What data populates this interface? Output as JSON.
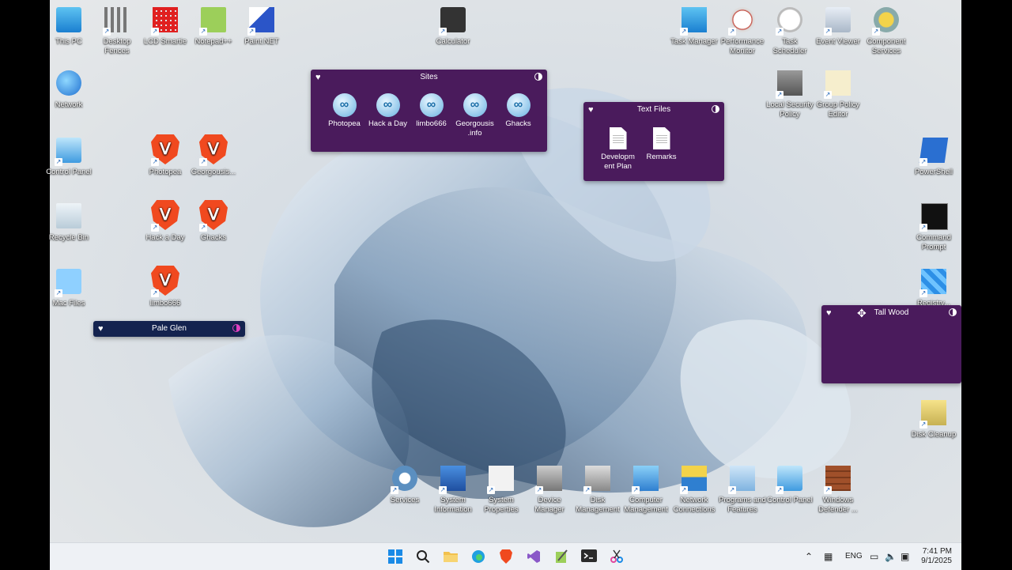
{
  "desktop_icons": [
    {
      "label": "This PC",
      "icon": "monitor-icon"
    },
    {
      "label": "Desktop Fences",
      "icon": "fence-icon"
    },
    {
      "label": "LCD Smartie",
      "icon": "lcd-icon"
    },
    {
      "label": "Notepad++",
      "icon": "notepadpp-icon"
    },
    {
      "label": "Paint.NET",
      "icon": "paint-icon"
    },
    {
      "label": "Calculator",
      "icon": "calculator-icon"
    },
    {
      "label": "Task Manager",
      "icon": "taskmanager-icon"
    },
    {
      "label": "Performance Monitor",
      "icon": "gauge-icon"
    },
    {
      "label": "Task Scheduler",
      "icon": "clock-icon"
    },
    {
      "label": "Event Viewer",
      "icon": "eventviewer-icon"
    },
    {
      "label": "Component Services",
      "icon": "component-icon"
    },
    {
      "label": "Network",
      "icon": "globe-icon"
    },
    {
      "label": "Local Security Policy",
      "icon": "security-icon"
    },
    {
      "label": "Group Policy Editor",
      "icon": "policy-icon"
    },
    {
      "label": "Control Panel",
      "icon": "controlpanel-icon"
    },
    {
      "label": "Photopea",
      "icon": "brave-icon"
    },
    {
      "label": "Georgousis...",
      "icon": "brave-icon"
    },
    {
      "label": "PowerShell",
      "icon": "powershell-icon"
    },
    {
      "label": "Recycle Bin",
      "icon": "recycle-icon"
    },
    {
      "label": "Hack a Day",
      "icon": "brave-icon"
    },
    {
      "label": "Ghacks",
      "icon": "brave-icon"
    },
    {
      "label": "Command Prompt",
      "icon": "cmd-icon"
    },
    {
      "label": "Mac Files",
      "icon": "folder-icon"
    },
    {
      "label": "limbo666",
      "icon": "brave-icon"
    },
    {
      "label": "Registry...",
      "icon": "registry-icon"
    },
    {
      "label": "Disk Cleanup",
      "icon": "diskcleanup-icon"
    },
    {
      "label": "Services",
      "icon": "gears-icon"
    },
    {
      "label": "System Information",
      "icon": "sysinfo-icon"
    },
    {
      "label": "System Properties",
      "icon": "sysprops-icon"
    },
    {
      "label": "Device Manager",
      "icon": "devmgr-icon"
    },
    {
      "label": "Disk Management",
      "icon": "diskmgmt-icon"
    },
    {
      "label": "Computer Management",
      "icon": "compmgmt-icon"
    },
    {
      "label": "Network Connections",
      "icon": "netconn-icon"
    },
    {
      "label": "Programs and Features",
      "icon": "programs-icon"
    },
    {
      "label": "Control Panel",
      "icon": "controlpanel-icon"
    },
    {
      "label": "Windows Defender ...",
      "icon": "firewall-icon"
    }
  ],
  "fences": {
    "sites": {
      "title": "Sites",
      "items": [
        "Photopea",
        "Hack a Day",
        "limbo666",
        "Georgousis .info",
        "Ghacks"
      ]
    },
    "text_files": {
      "title": "Text Files",
      "items": [
        "Developm ent Plan",
        "Remarks"
      ]
    },
    "pale_glen": {
      "title": "Pale Glen"
    },
    "tall_wood": {
      "title": "Tall Wood"
    }
  },
  "taskbar": {
    "apps": [
      "start-icon",
      "search-icon",
      "file-explorer-icon",
      "edge-icon",
      "brave-icon",
      "visual-studio-icon",
      "notepadpp-icon",
      "terminal-icon",
      "snipping-icon"
    ],
    "tray": {
      "language": "ENG",
      "time": "7:41 PM",
      "date": "9/1/2025"
    }
  },
  "colors": {
    "fence": "#4a1b5c",
    "pale_glen": "#14234f",
    "taskbar": "#eef1f5"
  }
}
